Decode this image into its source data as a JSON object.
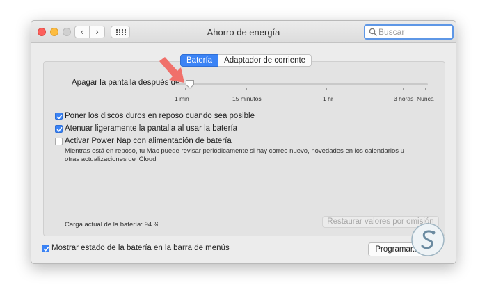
{
  "window": {
    "title": "Ahorro de energía"
  },
  "search": {
    "placeholder": "Buscar"
  },
  "nav": {
    "back": "‹",
    "forward": "›"
  },
  "tabs": [
    {
      "label": "Batería",
      "active": true
    },
    {
      "label": "Adaptador de corriente",
      "active": false
    }
  ],
  "display_sleep": {
    "label": "Apagar la pantalla después de:",
    "ticks": [
      "1 min",
      "15 minutos",
      "1 hr",
      "3 horas",
      "Nunca"
    ],
    "selected": "1 min"
  },
  "options": [
    {
      "label": "Poner los discos duros en reposo cuando sea posible",
      "checked": true
    },
    {
      "label": "Atenuar ligeramente la pantalla al usar la batería",
      "checked": true
    },
    {
      "label": "Activar Power Nap con alimentación de batería",
      "checked": false
    }
  ],
  "power_nap_desc": "Mientras está en reposo, tu Mac puede revisar periódicamente si hay correo nuevo, novedades en los calendarios u otras actualizaciones de iCloud",
  "battery_charge": "Carga actual de la batería: 94 %",
  "restore_button": "Restaurar valores por omisión",
  "menu_bar_status": {
    "label": "Mostrar estado de la batería en la barra de menús",
    "checked": true
  },
  "schedule_button": "Programar...",
  "colors": {
    "accent": "#3b83f5",
    "arrow": "#f0706a"
  },
  "icons": [
    "search-icon",
    "grid-icon",
    "checkmark-icon",
    "arrow-annotation-icon",
    "watermark-logo-icon"
  ]
}
